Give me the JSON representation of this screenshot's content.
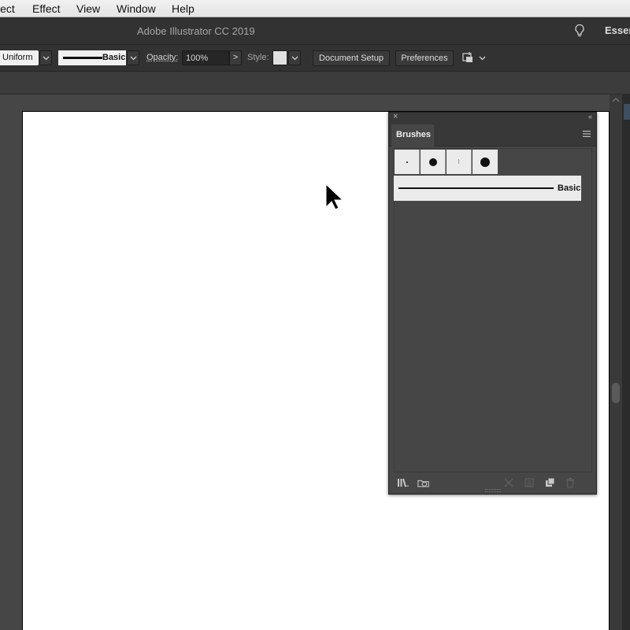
{
  "menubar": {
    "items": [
      "lect",
      "Effect",
      "View",
      "Window",
      "Help"
    ]
  },
  "titlebar": {
    "title": "Adobe Illustrator CC 2019",
    "workspace_label": "Esser"
  },
  "controlbar": {
    "variable_width_label": "Uniform",
    "brush_label": "Basic",
    "opacity_label": "Opacity:",
    "opacity_value": "100%",
    "opacity_arrow": ">",
    "style_label": "Style:",
    "document_setup_label": "Document Setup",
    "preferences_label": "Preferences"
  },
  "brushes_panel": {
    "close_glyph": "×",
    "collapse_glyph": "‹‹",
    "tab_label": "Brushes",
    "brush_list": [
      {
        "label": "Basic"
      }
    ],
    "footer_icons": [
      "brush-libraries-icon",
      "libraries-panel-icon",
      "remove-stroke-icon",
      "options-icon",
      "new-brush-icon",
      "delete-brush-icon"
    ]
  },
  "colors": {
    "chrome": "#323232",
    "panel": "#464646",
    "artboard": "#ffffff",
    "swatch_bg": "#ebebeb"
  }
}
